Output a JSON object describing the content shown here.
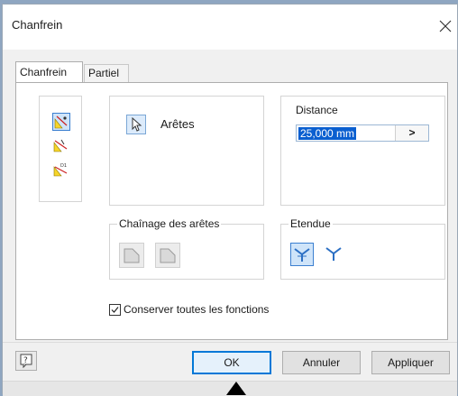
{
  "window": {
    "title": "Chanfrein",
    "close_icon": "close-icon"
  },
  "tabs": [
    {
      "label": "Chanfrein",
      "active": true
    },
    {
      "label": "Partiel",
      "active": false
    }
  ],
  "modes": {
    "icons": [
      "chamfer-distance-icon",
      "chamfer-distance-angle-icon",
      "chamfer-two-distances-icon"
    ],
    "selected_index": 0
  },
  "selection": {
    "label": "Arêtes",
    "icon": "cursor-select-icon"
  },
  "distance": {
    "label": "Distance",
    "value": "25,000 mm",
    "arrow": ">"
  },
  "chaining": {
    "legend": "Chaînage des arêtes",
    "icons": [
      "all-tangent-edges-icon",
      "single-edge-icon"
    ]
  },
  "extent": {
    "legend": "Etendue",
    "icons": [
      "setback-corner-icon",
      "no-setback-corner-icon"
    ],
    "selected_index": 0
  },
  "preserve": {
    "label": "Conserver toutes les fonctions",
    "checked": true
  },
  "buttons": {
    "help_icon": "help-icon",
    "ok": "OK",
    "cancel": "Annuler",
    "apply": "Appliquer"
  },
  "colors": {
    "accent": "#0078d7",
    "selection_highlight": "#0a5fd0",
    "active_button_bg": "#cfe4f9"
  }
}
